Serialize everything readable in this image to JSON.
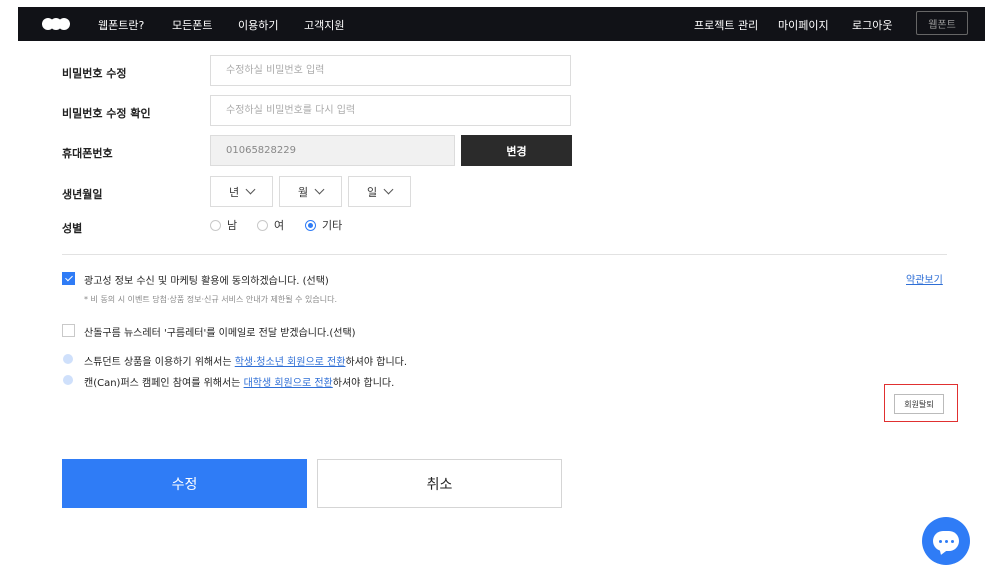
{
  "nav": {
    "left": [
      "웹폰트란?",
      "모든폰트",
      "이용하기",
      "고객지원"
    ],
    "right": [
      "프로젝트 관리",
      "마이페이지",
      "로그아웃"
    ],
    "button": "웹폰트"
  },
  "form": {
    "password_label": "비밀번호 수정",
    "password_placeholder": "수정하실 비밀번호 입력",
    "password_confirm_label": "비밀번호 수정 확인",
    "password_confirm_placeholder": "수정하실 비밀번호를 다시 입력",
    "phone_label": "휴대폰번호",
    "phone_value": "01065828229",
    "change_button": "변경",
    "birth_label": "생년월일",
    "birth_year": "년",
    "birth_month": "월",
    "birth_day": "일",
    "gender_label": "성별",
    "gender_options": [
      "남",
      "여",
      "기타"
    ],
    "gender_selected": "기타"
  },
  "consent": {
    "marketing_label": "광고성 정보 수신 및 마케팅 활용에 동의하겠습니다. (선택)",
    "marketing_checked": true,
    "marketing_note": "* 비 동의 시 이벤트 당첨·상품 정보·신규 서비스 안내가 제한될 수 있습니다.",
    "terms_link": "약관보기",
    "newsletter_label": "산돌구름 뉴스레터 '구름레터'를 이메일로 전달 받겠습니다.(선택)",
    "newsletter_checked": false
  },
  "info": {
    "student_pre": "스튜던트 상품을 이용하기 위해서는 ",
    "student_link": "학생·청소년 회원으로 전환",
    "student_post": "하셔야 합니다.",
    "campus_pre": "캔(Can)퍼스 캠페인 참여를 위해서는 ",
    "campus_link": "대학생 회원으로 전환",
    "campus_post": "하셔야 합니다."
  },
  "actions": {
    "withdraw": "회원탈퇴",
    "submit": "수정",
    "cancel": "취소"
  },
  "colors": {
    "accent": "#2f7cf6",
    "topbar": "#111217",
    "highlight_frame": "#e03030"
  },
  "icons": {
    "logo": "logo-dots",
    "chat": "chat-icon",
    "info": "info-icon",
    "select": "chevron-down-icon"
  }
}
